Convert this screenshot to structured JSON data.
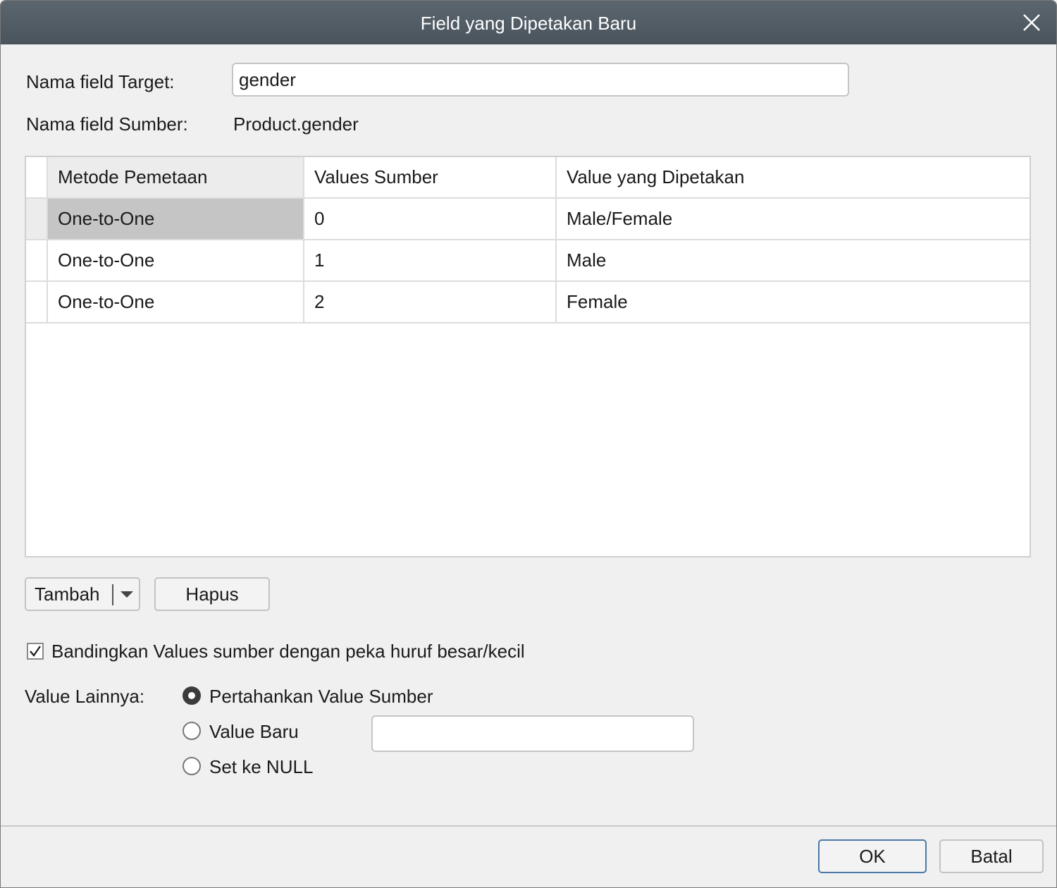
{
  "dialog": {
    "title": "Field yang Dipetakan Baru",
    "close_icon": "close-icon"
  },
  "target_field": {
    "label": "Nama field Target:",
    "value": "gender"
  },
  "source_field": {
    "label": "Nama field Sumber:",
    "value": "Product.gender"
  },
  "grid": {
    "columns": [
      "Metode Pemetaan",
      "Values Sumber",
      "Value yang Dipetakan"
    ],
    "rows": [
      {
        "method": "One-to-One",
        "source": "0",
        "mapped": "Male/Female",
        "selected": true
      },
      {
        "method": "One-to-One",
        "source": "1",
        "mapped": "Male",
        "selected": false
      },
      {
        "method": "One-to-One",
        "source": "2",
        "mapped": "Female",
        "selected": false
      }
    ]
  },
  "buttons": {
    "add": "Tambah",
    "remove": "Hapus",
    "ok": "OK",
    "cancel": "Batal"
  },
  "case_sensitive": {
    "label": "Bandingkan Values sumber dengan peka huruf besar/kecil",
    "checked": true
  },
  "other_values": {
    "label": "Value Lainnya:",
    "options": [
      "Pertahankan Value Sumber",
      "Value Baru",
      "Set ke NULL"
    ],
    "selected_index": 0,
    "new_value": ""
  }
}
